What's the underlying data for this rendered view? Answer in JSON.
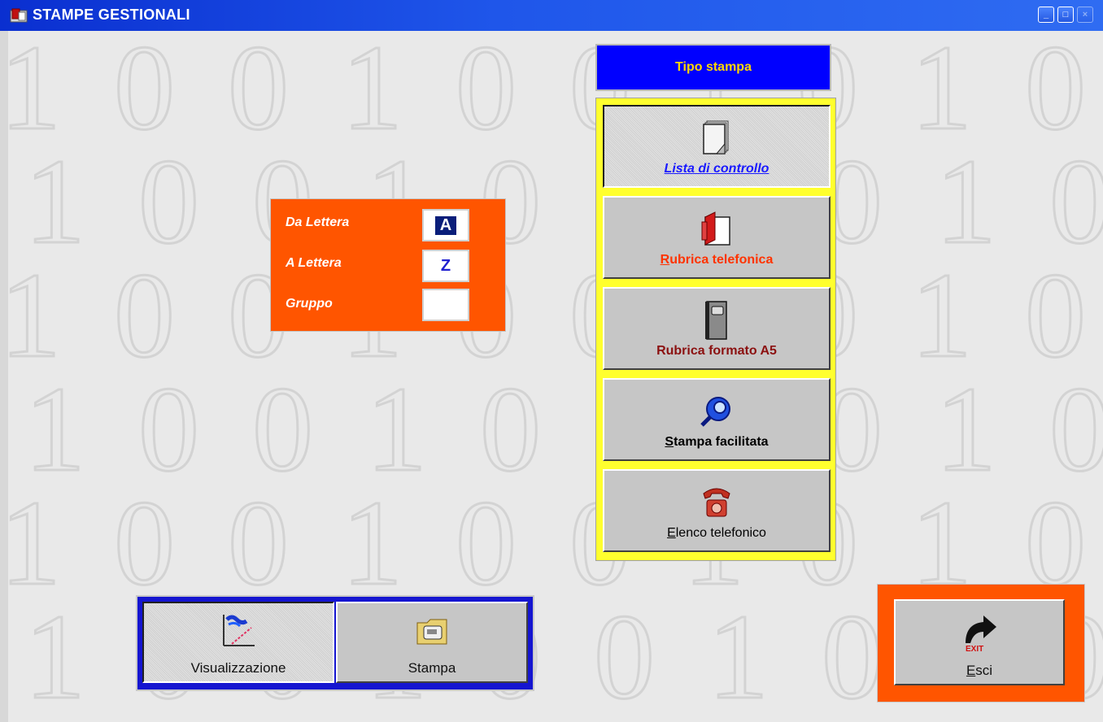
{
  "window": {
    "title": "STAMPE GESTIONALI",
    "controls": [
      "minimize",
      "maximize",
      "close"
    ]
  },
  "background": {
    "pattern_digits": [
      "1",
      "0",
      "0",
      "1",
      "0",
      "0",
      "1",
      "0",
      "1",
      "0"
    ]
  },
  "letter_filter": {
    "da_label": "Da Lettera",
    "da_value": "A",
    "a_label": "A Lettera",
    "a_value": "Z",
    "gruppo_label": "Gruppo",
    "gruppo_value": ""
  },
  "tipo_stampa": {
    "header": "Tipo stampa",
    "options": [
      {
        "label_prefix": "",
        "label_underline": "",
        "label_rest": "Lista di controllo",
        "icon": "document-icon",
        "selected": true,
        "color": "#1a1aff",
        "italic": true
      },
      {
        "label_prefix": "",
        "label_underline": "R",
        "label_rest": "ubrica telefonica",
        "icon": "address-book-icon",
        "selected": false,
        "color": "#ff3300",
        "italic": false
      },
      {
        "label_prefix": "",
        "label_underline": "",
        "label_rest": "Rubrica formato A5",
        "icon": "notebook-icon",
        "selected": false,
        "color": "#8b1010",
        "italic": false
      },
      {
        "label_prefix": "",
        "label_underline": "S",
        "label_rest": "tampa facilitata",
        "icon": "magnifier-globe-icon",
        "selected": false,
        "color": "#000000",
        "italic": false
      },
      {
        "label_prefix": "",
        "label_underline": "E",
        "label_rest": "lenco telefonico",
        "icon": "telephone-icon",
        "selected": false,
        "color": "#000000",
        "italic": false
      }
    ]
  },
  "output_mode": {
    "preview_label": "Visualizzazione",
    "print_label": "Stampa",
    "selected": "preview"
  },
  "exit": {
    "label_underline": "E",
    "label_rest": "sci",
    "icon_text": "EXIT"
  },
  "colors": {
    "title_bar": "#1f56ea",
    "orange_panel": "#ff5500",
    "yellow_panel": "#ffff2e",
    "blue_header": "#0000ff",
    "header_text": "#ffd700"
  }
}
